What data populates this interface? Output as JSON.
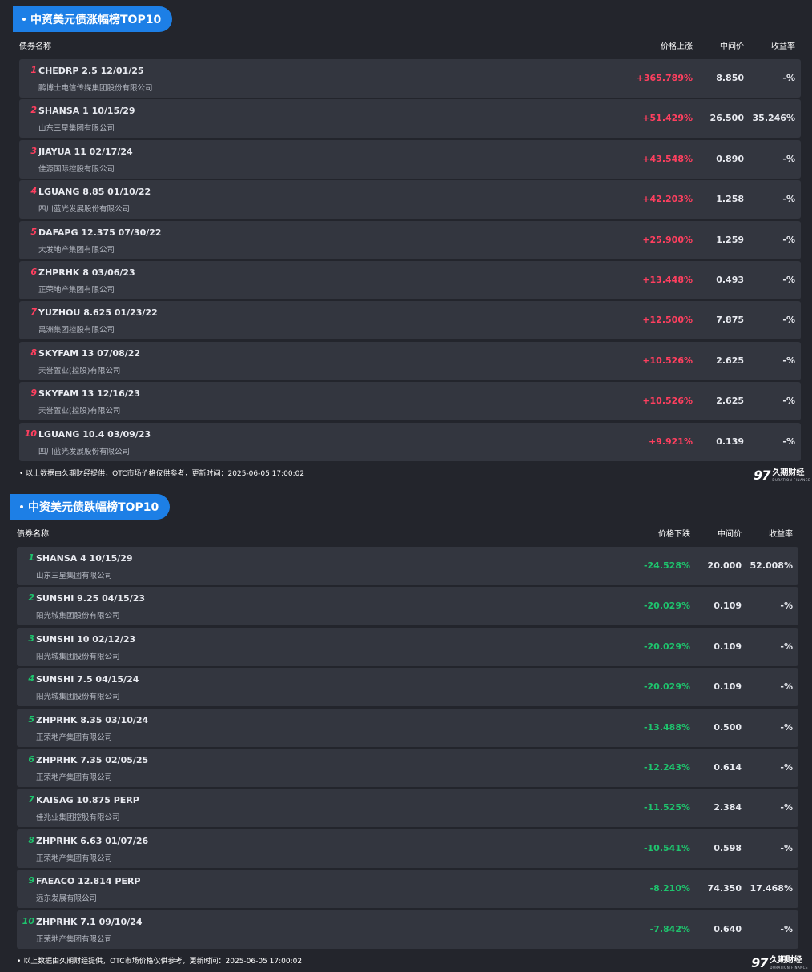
{
  "gainers": {
    "title": "中资美元债涨幅榜TOP10",
    "headers": {
      "name": "债券名称",
      "change": "价格上涨",
      "mid": "中间价",
      "yield": "收益率"
    },
    "rows": [
      {
        "rank": "1",
        "code": "CHEDRP 2.5 12/01/25",
        "issuer": "鹏博士电信传媒集团股份有限公司",
        "change": "+365.789%",
        "mid": "8.850",
        "yield": "-%"
      },
      {
        "rank": "2",
        "code": "SHANSA 1 10/15/29",
        "issuer": "山东三星集团有限公司",
        "change": "+51.429%",
        "mid": "26.500",
        "yield": "35.246%"
      },
      {
        "rank": "3",
        "code": "JIAYUA 11 02/17/24",
        "issuer": "佳源国际控股有限公司",
        "change": "+43.548%",
        "mid": "0.890",
        "yield": "-%"
      },
      {
        "rank": "4",
        "code": "LGUANG 8.85 01/10/22",
        "issuer": "四川蓝光发展股份有限公司",
        "change": "+42.203%",
        "mid": "1.258",
        "yield": "-%"
      },
      {
        "rank": "5",
        "code": "DAFAPG 12.375 07/30/22",
        "issuer": "大发地产集团有限公司",
        "change": "+25.900%",
        "mid": "1.259",
        "yield": "-%"
      },
      {
        "rank": "6",
        "code": "ZHPRHK 8 03/06/23",
        "issuer": "正荣地产集团有限公司",
        "change": "+13.448%",
        "mid": "0.493",
        "yield": "-%"
      },
      {
        "rank": "7",
        "code": "YUZHOU 8.625 01/23/22",
        "issuer": "禹洲集团控股有限公司",
        "change": "+12.500%",
        "mid": "7.875",
        "yield": "-%"
      },
      {
        "rank": "8",
        "code": "SKYFAM 13 07/08/22",
        "issuer": "天誉置业(控股)有限公司",
        "change": "+10.526%",
        "mid": "2.625",
        "yield": "-%"
      },
      {
        "rank": "9",
        "code": "SKYFAM 13 12/16/23",
        "issuer": "天誉置业(控股)有限公司",
        "change": "+10.526%",
        "mid": "2.625",
        "yield": "-%"
      },
      {
        "rank": "10",
        "code": "LGUANG 10.4 03/09/23",
        "issuer": "四川蓝光发展股份有限公司",
        "change": "+9.921%",
        "mid": "0.139",
        "yield": "-%"
      }
    ],
    "footer": "• 以上数据由久期财经提供，OTC市场价格仅供参考，更新时间：2025-06-05 17:00:02"
  },
  "losers": {
    "title": "中资美元债跌幅榜TOP10",
    "headers": {
      "name": "债券名称",
      "change": "价格下跌",
      "mid": "中间价",
      "yield": "收益率"
    },
    "rows": [
      {
        "rank": "1",
        "code": "SHANSA 4 10/15/29",
        "issuer": "山东三星集团有限公司",
        "change": "-24.528%",
        "mid": "20.000",
        "yield": "52.008%"
      },
      {
        "rank": "2",
        "code": "SUNSHI 9.25 04/15/23",
        "issuer": "阳光城集团股份有限公司",
        "change": "-20.029%",
        "mid": "0.109",
        "yield": "-%"
      },
      {
        "rank": "3",
        "code": "SUNSHI 10 02/12/23",
        "issuer": "阳光城集团股份有限公司",
        "change": "-20.029%",
        "mid": "0.109",
        "yield": "-%"
      },
      {
        "rank": "4",
        "code": "SUNSHI 7.5 04/15/24",
        "issuer": "阳光城集团股份有限公司",
        "change": "-20.029%",
        "mid": "0.109",
        "yield": "-%"
      },
      {
        "rank": "5",
        "code": "ZHPRHK 8.35 03/10/24",
        "issuer": "正荣地产集团有限公司",
        "change": "-13.488%",
        "mid": "0.500",
        "yield": "-%"
      },
      {
        "rank": "6",
        "code": "ZHPRHK 7.35 02/05/25",
        "issuer": "正荣地产集团有限公司",
        "change": "-12.243%",
        "mid": "0.614",
        "yield": "-%"
      },
      {
        "rank": "7",
        "code": "KAISAG 10.875 PERP",
        "issuer": "佳兆业集团控股有限公司",
        "change": "-11.525%",
        "mid": "2.384",
        "yield": "-%"
      },
      {
        "rank": "8",
        "code": "ZHPRHK 6.63 01/07/26",
        "issuer": "正荣地产集团有限公司",
        "change": "-10.541%",
        "mid": "0.598",
        "yield": "-%"
      },
      {
        "rank": "9",
        "code": "FAEACO 12.814 PERP",
        "issuer": "远东发展有限公司",
        "change": "-8.210%",
        "mid": "74.350",
        "yield": "17.468%"
      },
      {
        "rank": "10",
        "code": "ZHPRHK 7.1 09/10/24",
        "issuer": "正荣地产集团有限公司",
        "change": "-7.842%",
        "mid": "0.640",
        "yield": "-%"
      }
    ],
    "footer": "• 以上数据由久期财经提供，OTC市场价格仅供参考，更新时间：2025-06-05 17:00:02"
  },
  "logo": {
    "mark": "97",
    "cn": "久期财经",
    "en": "DURATION FINANCE"
  },
  "colors": {
    "accent": "#1d7fe6",
    "up": "#ff3f5f",
    "down": "#1ec46d",
    "row_bg": "#33363f",
    "page_bg": "#23252c"
  }
}
